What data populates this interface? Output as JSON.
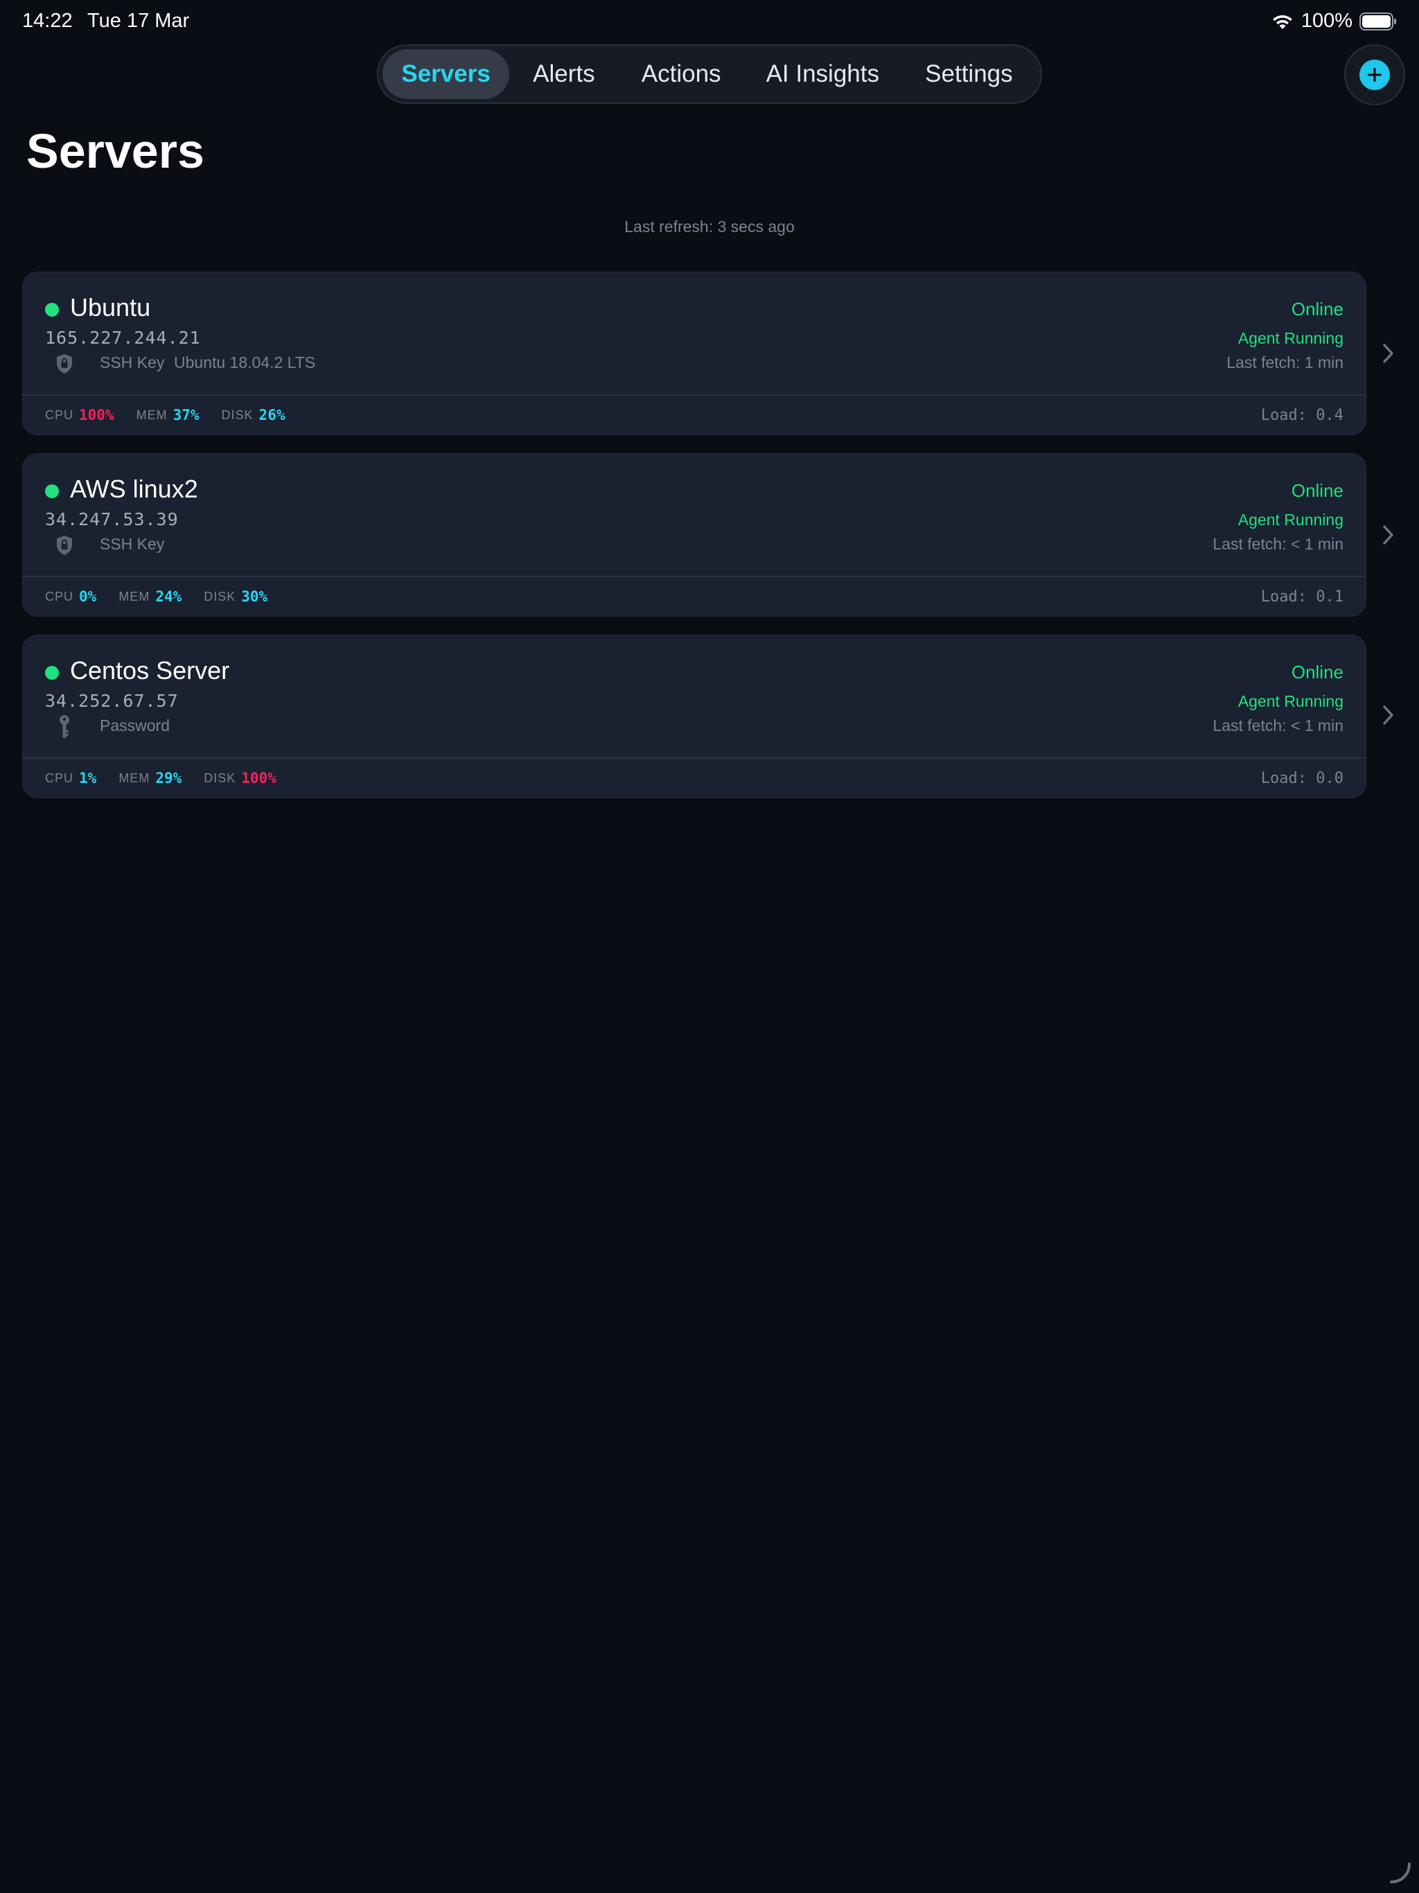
{
  "status_bar": {
    "time": "14:22",
    "date": "Tue 17 Mar",
    "battery": "100%",
    "icons": [
      "wifi-icon",
      "battery-icon"
    ]
  },
  "nav": {
    "tabs": [
      {
        "label": "Servers",
        "active": true
      },
      {
        "label": "Alerts",
        "active": false
      },
      {
        "label": "Actions",
        "active": false
      },
      {
        "label": "AI Insights",
        "active": false
      },
      {
        "label": "Settings",
        "active": false
      }
    ],
    "add_icon": "plus-icon"
  },
  "page": {
    "title": "Servers",
    "last_refresh": "Last refresh: 3 secs ago"
  },
  "colors": {
    "accent": "#28d6f0",
    "online": "#20e07f",
    "metric_normal": "#28d6f0",
    "metric_critical": "#f0245a",
    "card_bg": "#1a2130",
    "page_bg": "#0a0d14"
  },
  "servers": [
    {
      "name": "Ubuntu",
      "ip": "165.227.244.21",
      "auth_icon": "shield-lock-icon",
      "auth": "SSH Key",
      "os": "Ubuntu 18.04.2 LTS",
      "status": "Online",
      "agent": "Agent Running",
      "last_fetch": "Last fetch: 1 min",
      "cpu_label": "CPU",
      "cpu": "100%",
      "cpu_critical": true,
      "mem_label": "MEM",
      "mem": "37%",
      "mem_critical": false,
      "disk_label": "DISK",
      "disk": "26%",
      "disk_critical": false,
      "load": "Load: 0.4"
    },
    {
      "name": "AWS linux2",
      "ip": "34.247.53.39",
      "auth_icon": "shield-lock-icon",
      "auth": "SSH Key",
      "os": "",
      "status": "Online",
      "agent": "Agent Running",
      "last_fetch": "Last fetch: < 1 min",
      "cpu_label": "CPU",
      "cpu": "0%",
      "cpu_critical": false,
      "mem_label": "MEM",
      "mem": "24%",
      "mem_critical": false,
      "disk_label": "DISK",
      "disk": "30%",
      "disk_critical": false,
      "load": "Load: 0.1"
    },
    {
      "name": "Centos Server",
      "ip": "34.252.67.57",
      "auth_icon": "key-icon",
      "auth": "Password",
      "os": "",
      "status": "Online",
      "agent": "Agent Running",
      "last_fetch": "Last fetch: < 1 min",
      "cpu_label": "CPU",
      "cpu": "1%",
      "cpu_critical": false,
      "mem_label": "MEM",
      "mem": "29%",
      "mem_critical": false,
      "disk_label": "DISK",
      "disk": "100%",
      "disk_critical": true,
      "load": "Load: 0.0"
    }
  ]
}
